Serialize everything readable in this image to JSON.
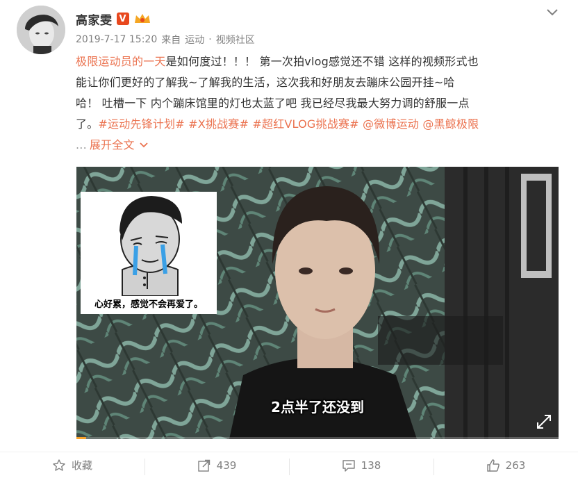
{
  "header": {
    "user_name": "高家雯",
    "verified_label": "V",
    "date": "2019-7-17 15:20",
    "source_prefix": "来自",
    "source_app": "运动",
    "separator": "·",
    "community": "视频社区",
    "menu_icon": "chevron-down-icon"
  },
  "post": {
    "line1_highlight": "极限运动员的一天",
    "line1_rest": "是如何度过！！！  第一次拍vlog感觉还不错 这样的视频形式也",
    "line2": "能让你们更好的了解我~了解我的生活，这次我和好朋友去蹦床公园开挂~哈",
    "line3": "哈！ 吐槽一下 内个蹦床馆里的灯也太蓝了吧 我已经尽我最大努力调的舒服一点",
    "line4_prefix": "了。",
    "tags": [
      "#运动先锋计划#",
      "#X挑战赛#",
      "#超红VLOG挑战赛#"
    ],
    "mentions": [
      "@微博运动",
      "@黑鲸极限"
    ],
    "ellipsis": "...",
    "expand_label": "展开全文"
  },
  "video": {
    "meme_caption": "心好累，感觉不会再爱了。",
    "subtitle": "2点半了还没到",
    "progress_fraction": 0.02,
    "fullscreen_icon": "fullscreen-icon"
  },
  "actions": {
    "favorite_label": "收藏",
    "repost_count": "439",
    "comment_count": "138",
    "like_count": "263"
  },
  "colors": {
    "accent": "#eb7350",
    "text": "#333333",
    "muted": "#808080"
  }
}
